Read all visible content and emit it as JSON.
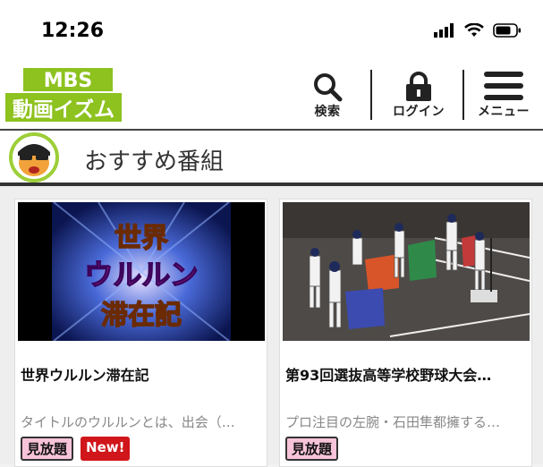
{
  "status_bar": {
    "time": "12:26"
  },
  "header": {
    "logo_top": "MBS",
    "logo_bottom": "動画イズム",
    "search_label": "検索",
    "login_label": "ログイン",
    "menu_label": "メニュー"
  },
  "section": {
    "title": "おすすめ番組"
  },
  "cards": [
    {
      "thumb_text": [
        "世界",
        "ウルルン",
        "滞在記"
      ],
      "title": "世界ウルルン滞在記",
      "description": "タイトルのウルルンとは、出会（…",
      "tags": [
        "見放題",
        "New!"
      ]
    },
    {
      "title": "第93回選抜高等学校野球大会…",
      "description": "プロ注目の左腕・石田隼都擁する…",
      "tags": [
        "見放題"
      ]
    }
  ],
  "colors": {
    "logo_green": "#8dc21f",
    "tag_pink": "#f7c3d8",
    "tag_red": "#d0161b"
  }
}
